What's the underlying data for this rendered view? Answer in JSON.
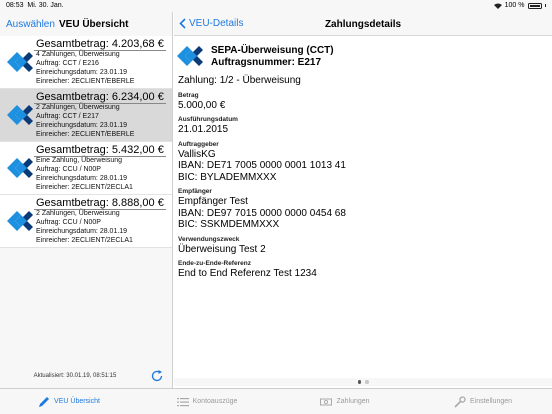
{
  "status_bar": {
    "time": "08:53",
    "date": "Mi. 30. Jan.",
    "battery": "100 %"
  },
  "master": {
    "back_label": "Auswählen",
    "title": "VEU Übersicht",
    "orders": [
      {
        "amount": "Gesamtbetrag: 4.203,68 €",
        "line1": "4 Zahlungen, Überweisung",
        "line2": "Auftrag: CCT / E216",
        "line3": "Einreichungsdatum: 23.01.19",
        "line4": "Einreicher: 2ECLIENT/EBERLE",
        "selected": false
      },
      {
        "amount": "Gesamtbetrag: 6.234,00 €",
        "line1": "2 Zahlungen, Überweisung",
        "line2": "Auftrag: CCT / E217",
        "line3": "Einreichungsdatum: 23.01.19",
        "line4": "Einreicher: 2ECLIENT/EBERLE",
        "selected": true
      },
      {
        "amount": "Gesamtbetrag: 5.432,00 €",
        "line1": "Eine Zahlung, Überweisung",
        "line2": "Auftrag: CCU / N00P",
        "line3": "Einreichungsdatum: 28.01.19",
        "line4": "Einreicher: 2ECLIENT/2ECLA1",
        "selected": false
      },
      {
        "amount": "Gesamtbetrag: 8.888,00 €",
        "line1": "2 Zahlungen, Überweisung",
        "line2": "Auftrag: CCU / N00P",
        "line3": "Einreichungsdatum: 28.01.19",
        "line4": "Einreicher: 2ECLIENT/2ECLA1",
        "selected": false
      }
    ],
    "updated": "Aktualisiert: 30.01.19, 08:51:15"
  },
  "detail": {
    "back_label": "VEU-Details",
    "title": "Zahlungsdetails",
    "header_title": "SEPA-Überweisung (CCT)",
    "header_order": "Auftragsnummer: E217",
    "payment_index": "Zahlung: 1/2 - Überweisung",
    "amount_label": "Betrag",
    "amount": "5.000,00 €",
    "exec_date_label": "Ausführungsdatum",
    "exec_date": "21.01.2015",
    "payer_label": "Auftraggeber",
    "payer_name": "VallisKG",
    "payer_iban": "IBAN: DE71 7005 0000 0001 1013 41",
    "payer_bic": "BIC: BYLADEMMXXX",
    "payee_label": "Empfänger",
    "payee_name": "Empfänger Test",
    "payee_iban": "IBAN: DE97 7015 0000 0000 0454 68",
    "payee_bic": "BIC: SSKMDEMMXXX",
    "purpose_label": "Verwendungszweck",
    "purpose": "Überweisung Test 2",
    "e2e_label": "Ende-zu-Ende-Referenz",
    "e2e": "End to End Referenz Test 1234"
  },
  "tabs": [
    {
      "label": "VEU Übersicht",
      "icon": "pen-icon",
      "active": true
    },
    {
      "label": "Kontoauszüge",
      "icon": "list-icon",
      "active": false
    },
    {
      "label": "Zahlungen",
      "icon": "money-icon",
      "active": false
    },
    {
      "label": "Einstellungen",
      "icon": "wrench-icon",
      "active": false
    }
  ],
  "colors": {
    "accent": "#1f7ae0",
    "logo_blue": "#1e90e0",
    "logo_dark": "#0b3a78"
  }
}
